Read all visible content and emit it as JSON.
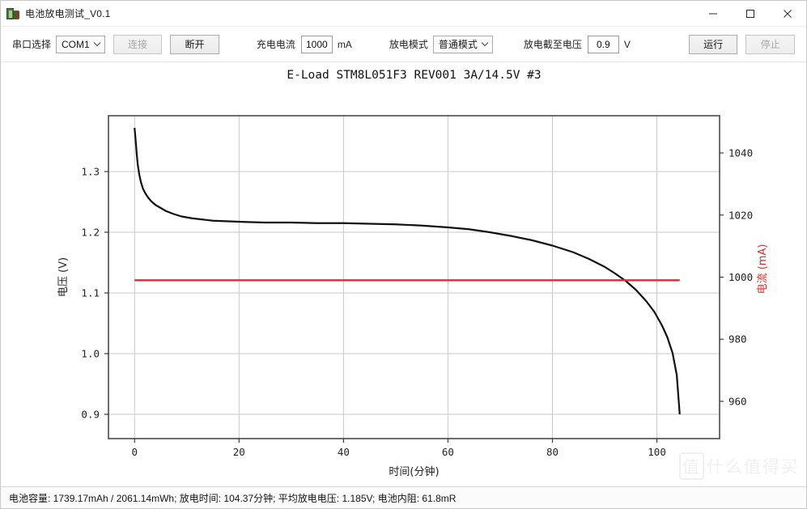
{
  "window": {
    "title": "电池放电测试_V0.1",
    "icon": "battery-plug-icon",
    "minimize_label": "minimize-icon",
    "maximize_label": "maximize-icon",
    "close_label": "close-icon"
  },
  "toolbar": {
    "port_label": "串口选择",
    "port_value": "COM1",
    "connect_label": "连接",
    "connect_enabled": false,
    "disconnect_label": "断开",
    "disconnect_enabled": true,
    "charge_current_label": "充电电流",
    "charge_current_value": "1000",
    "charge_current_unit": "mA",
    "mode_label": "放电模式",
    "mode_value": "普通模式",
    "cutoff_label": "放电截至电压",
    "cutoff_value": "0.9",
    "cutoff_unit": "V",
    "run_label": "运行",
    "run_enabled": true,
    "stop_label": "停止",
    "stop_enabled": false
  },
  "statusbar": {
    "text": "电池容量: 1739.17mAh / 2061.14mWh;  放电时间: 104.37分钟;  平均放电电压: 1.185V;  电池内阻: 61.8mR"
  },
  "watermark": {
    "badge": "值",
    "text": "什么值得买"
  },
  "chart_data": {
    "type": "line",
    "title": "E-Load STM8L051F3 REV001 3A/14.5V #3",
    "xlabel": "时间(分钟)",
    "ylabel": "电压 (V)",
    "y2label": "电流 (mA)",
    "xlim": [
      -5,
      112
    ],
    "ylim": [
      0.86,
      1.392
    ],
    "y2lim": [
      948,
      1052
    ],
    "xticks": [
      0,
      20,
      40,
      60,
      80,
      100
    ],
    "yticks": [
      0.9,
      1.0,
      1.1,
      1.2,
      1.3
    ],
    "y2ticks": [
      960,
      980,
      1000,
      1020,
      1040
    ],
    "grid": true,
    "legend": "none",
    "series": [
      {
        "name": "电压 (V)",
        "axis": "left",
        "color": "#111111",
        "x": [
          0.0,
          0.2,
          0.4,
          0.6,
          0.9,
          1.2,
          1.6,
          2.0,
          2.6,
          3.2,
          4.0,
          5.0,
          6.0,
          7.5,
          9.0,
          11.0,
          13.0,
          15.0,
          18.0,
          21.0,
          25.0,
          30.0,
          35.0,
          40.0,
          45.0,
          50.0,
          55.0,
          60.0,
          64.0,
          68.0,
          72.0,
          76.0,
          80.0,
          84.0,
          87.0,
          90.0,
          92.0,
          94.0,
          96.0,
          98.0,
          99.5,
          101.0,
          102.0,
          103.0,
          103.8,
          104.37
        ],
        "y": [
          1.372,
          1.352,
          1.33,
          1.312,
          1.295,
          1.283,
          1.272,
          1.265,
          1.257,
          1.251,
          1.245,
          1.24,
          1.235,
          1.23,
          1.226,
          1.223,
          1.221,
          1.219,
          1.218,
          1.217,
          1.216,
          1.216,
          1.215,
          1.215,
          1.214,
          1.213,
          1.211,
          1.208,
          1.205,
          1.2,
          1.194,
          1.187,
          1.178,
          1.167,
          1.156,
          1.143,
          1.132,
          1.12,
          1.105,
          1.086,
          1.069,
          1.046,
          1.027,
          1.001,
          0.965,
          0.9
        ]
      },
      {
        "name": "电流 (mA)",
        "axis": "right",
        "color": "#e02b2b",
        "x": [
          0.0,
          104.37
        ],
        "y": [
          999.0,
          999.0
        ]
      }
    ]
  }
}
